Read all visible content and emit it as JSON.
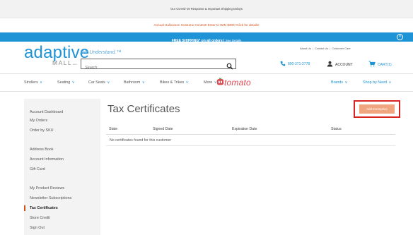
{
  "announcements": {
    "covid": "Our COVID-19 Response & Important Shipping Delays",
    "halloween": "Annual Halloween Costume Contest! Enter to WIN $300! Click for details!",
    "shipping": "FREE SHIPPING* on all orders",
    "shipping_sep": "|",
    "shipping_link": "See Details",
    "close_glyph": "×"
  },
  "header": {
    "logo_main": "adaptive",
    "logo_sub": "MALL",
    "logo_sub_small": ".com",
    "tagline": "We Understand.™",
    "search_placeholder": "Search",
    "top_links": [
      "About Us",
      "Contact Us",
      "Customer Care"
    ],
    "phone": "800-371-2778",
    "account": "ACCOUNT",
    "cart": "CART(1)"
  },
  "nav": {
    "items": [
      "Strollers",
      "Seating",
      "Car Seats",
      "Bathroom",
      "Bikes & Trikes",
      "More"
    ],
    "chevron": "∨",
    "tomato_brand": "tomato",
    "right_items": [
      "Brands",
      "Shop by Need"
    ]
  },
  "sidebar": {
    "items": [
      "Account Dashboard",
      "My Orders",
      "Order by SKU",
      "Address Book",
      "Account Information",
      "Gift Card",
      "My Product Reviews",
      "Newsletter Subscriptions",
      "Tax Certificates",
      "Store Credit",
      "Sign Out"
    ],
    "active_index": 8
  },
  "main": {
    "title": "Tax Certificates",
    "add_button": "Add Exemption",
    "columns": [
      "State",
      "Signed Date",
      "Expiration Date",
      "Status"
    ],
    "empty_message": "No certificates found for this customer"
  },
  "colors": {
    "brand_blue": "#1e93d6",
    "halloween_orange": "#d2531b",
    "add_button_bg": "#f1a57f",
    "highlight_red": "#d92424",
    "tomato_red": "#d94d55"
  },
  "icons": {
    "search": "search-icon",
    "phone": "phone-icon",
    "account": "user-icon",
    "cart": "cart-icon",
    "close": "close-circle-icon",
    "chevron": "chevron-down-icon"
  }
}
